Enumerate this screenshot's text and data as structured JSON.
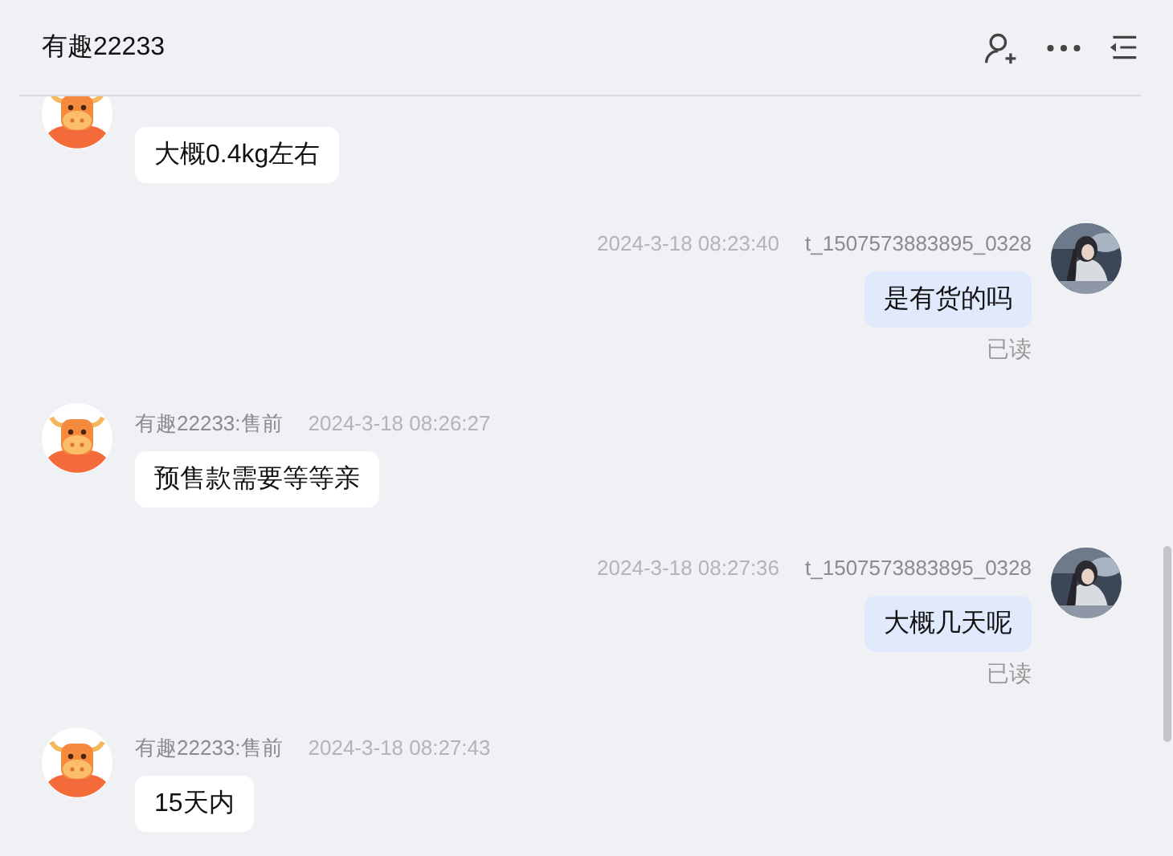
{
  "header": {
    "title": "有趣22233"
  },
  "messages": [
    {
      "kind": "incoming",
      "text": "大概0.4kg左右"
    },
    {
      "kind": "outgoing",
      "time": "2024-3-18 08:23:40",
      "sender": "t_1507573883895_0328",
      "text": "是有货的吗",
      "status": "已读"
    },
    {
      "kind": "incoming",
      "sender": "有趣22233:售前",
      "time": "2024-3-18 08:26:27",
      "text": "预售款需要等等亲"
    },
    {
      "kind": "outgoing",
      "time": "2024-3-18 08:27:36",
      "sender": "t_1507573883895_0328",
      "text": "大概几天呢",
      "status": "已读"
    },
    {
      "kind": "incoming",
      "sender": "有趣22233:售前",
      "time": "2024-3-18 08:27:43",
      "text": "15天内"
    }
  ]
}
